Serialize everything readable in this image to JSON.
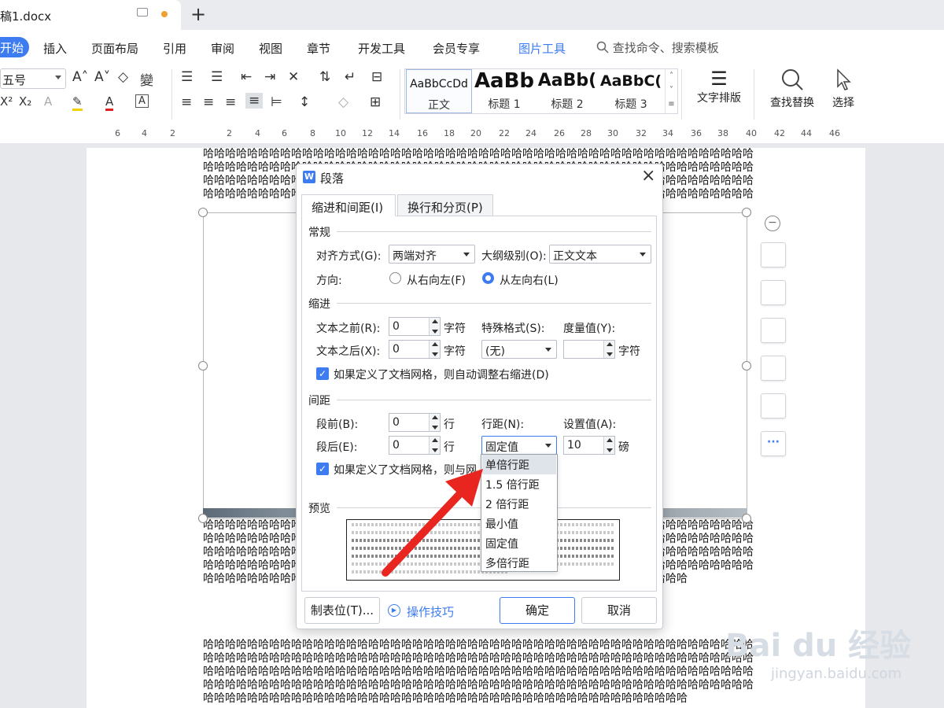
{
  "titlebar": {
    "doc_name": "稿1.docx",
    "new_tab": "+"
  },
  "menubar": {
    "items": [
      "开始",
      "插入",
      "页面布局",
      "引用",
      "审阅",
      "视图",
      "章节",
      "开发工具",
      "会员专享",
      "图片工具"
    ],
    "search": "查找命令、搜索模板"
  },
  "ribbon": {
    "font_size": "五号",
    "styles": [
      {
        "sample": "AaBbCcDd",
        "name": "正文"
      },
      {
        "sample": "AaBb",
        "name": "标题 1"
      },
      {
        "sample": "AaBb(",
        "name": "标题 2"
      },
      {
        "sample": "AaBbC(",
        "name": "标题 3"
      }
    ],
    "text_layout": "文字排版",
    "find_replace": "查找替换",
    "select": "选择"
  },
  "ruler": [
    "6",
    "4",
    "2",
    "2",
    "4",
    "6",
    "8",
    "10",
    "12",
    "14",
    "16",
    "18",
    "20",
    "22",
    "24",
    "26",
    "28",
    "30",
    "32",
    "34",
    "36",
    "38",
    "40",
    "42",
    "44",
    "46"
  ],
  "document": {
    "repeat_text": "哈哈哈哈哈哈哈哈哈哈哈哈哈哈哈哈哈哈哈哈哈哈哈哈哈哈哈哈哈哈哈哈哈哈哈哈哈哈哈哈哈哈哈哈哈哈哈哈哈哈哈哈哈哈哈哈哈哈哈哈哈哈哈哈哈哈哈哈哈哈哈哈哈哈哈哈哈哈哈哈哈哈哈哈哈哈哈哈哈哈哈哈哈哈哈哈哈哈哈哈哈哈哈哈哈哈哈哈哈哈哈哈哈哈哈哈哈哈哈哈哈哈哈哈哈哈哈哈哈哈哈哈哈哈哈哈哈哈哈哈哈哈哈哈哈哈哈哈哈哈哈哈哈哈哈哈哈哈哈哈哈哈哈哈哈哈哈哈哈哈哈哈哈哈哈哈哈哈哈哈哈哈哈哈哈哈哈哈哈哈哈哈哈哈哈哈哈哈哈哈哈哈哈哈哈哈哈哈哈哈哈哈哈哈哈哈哈哈哈哈哈哈哈哈哈哈哈哈哈哈哈哈哈哈哈哈哈哈哈哈哈哈哈哈"
  },
  "dialog": {
    "title": "段落",
    "tabs": [
      "缩进和间距(I)",
      "换行和分页(P)"
    ],
    "general": {
      "heading": "常规",
      "align_label": "对齐方式(G):",
      "align_value": "两端对齐",
      "outline_label": "大纲级别(O):",
      "outline_value": "正文文本",
      "direction_label": "方向:",
      "rtl": "从右向左(F)",
      "ltr": "从左向右(L)"
    },
    "indent": {
      "heading": "缩进",
      "before_label": "文本之前(R):",
      "before_value": "0",
      "after_label": "文本之后(X):",
      "after_value": "0",
      "unit": "字符",
      "special_label": "特殊格式(S):",
      "special_value": "(无)",
      "measure_label": "度量值(Y):",
      "measure_unit": "字符",
      "grid_check": "如果定义了文档网格，则自动调整右缩进(D)"
    },
    "spacing": {
      "heading": "间距",
      "before_label": "段前(B):",
      "before_value": "0",
      "after_label": "段后(E):",
      "after_value": "0",
      "unit": "行",
      "line_label": "行距(N):",
      "line_value": "固定值",
      "set_label": "设置值(A):",
      "set_value": "10",
      "set_unit": "磅",
      "grid_check": "如果定义了文档网格，则与网"
    },
    "preview_label": "预览",
    "tabs_button": "制表位(T)...",
    "tips": "操作技巧",
    "ok": "确定",
    "cancel": "取消"
  },
  "line_spacing_options": [
    "单倍行距",
    "1.5 倍行距",
    "2 倍行距",
    "最小值",
    "固定值",
    "多倍行距"
  ],
  "watermark": {
    "text": "Bai du 经验",
    "sub": "jingyan.baidu.com"
  },
  "colors": {
    "accent": "#3d7cf0",
    "arrow": "#e8251e"
  }
}
